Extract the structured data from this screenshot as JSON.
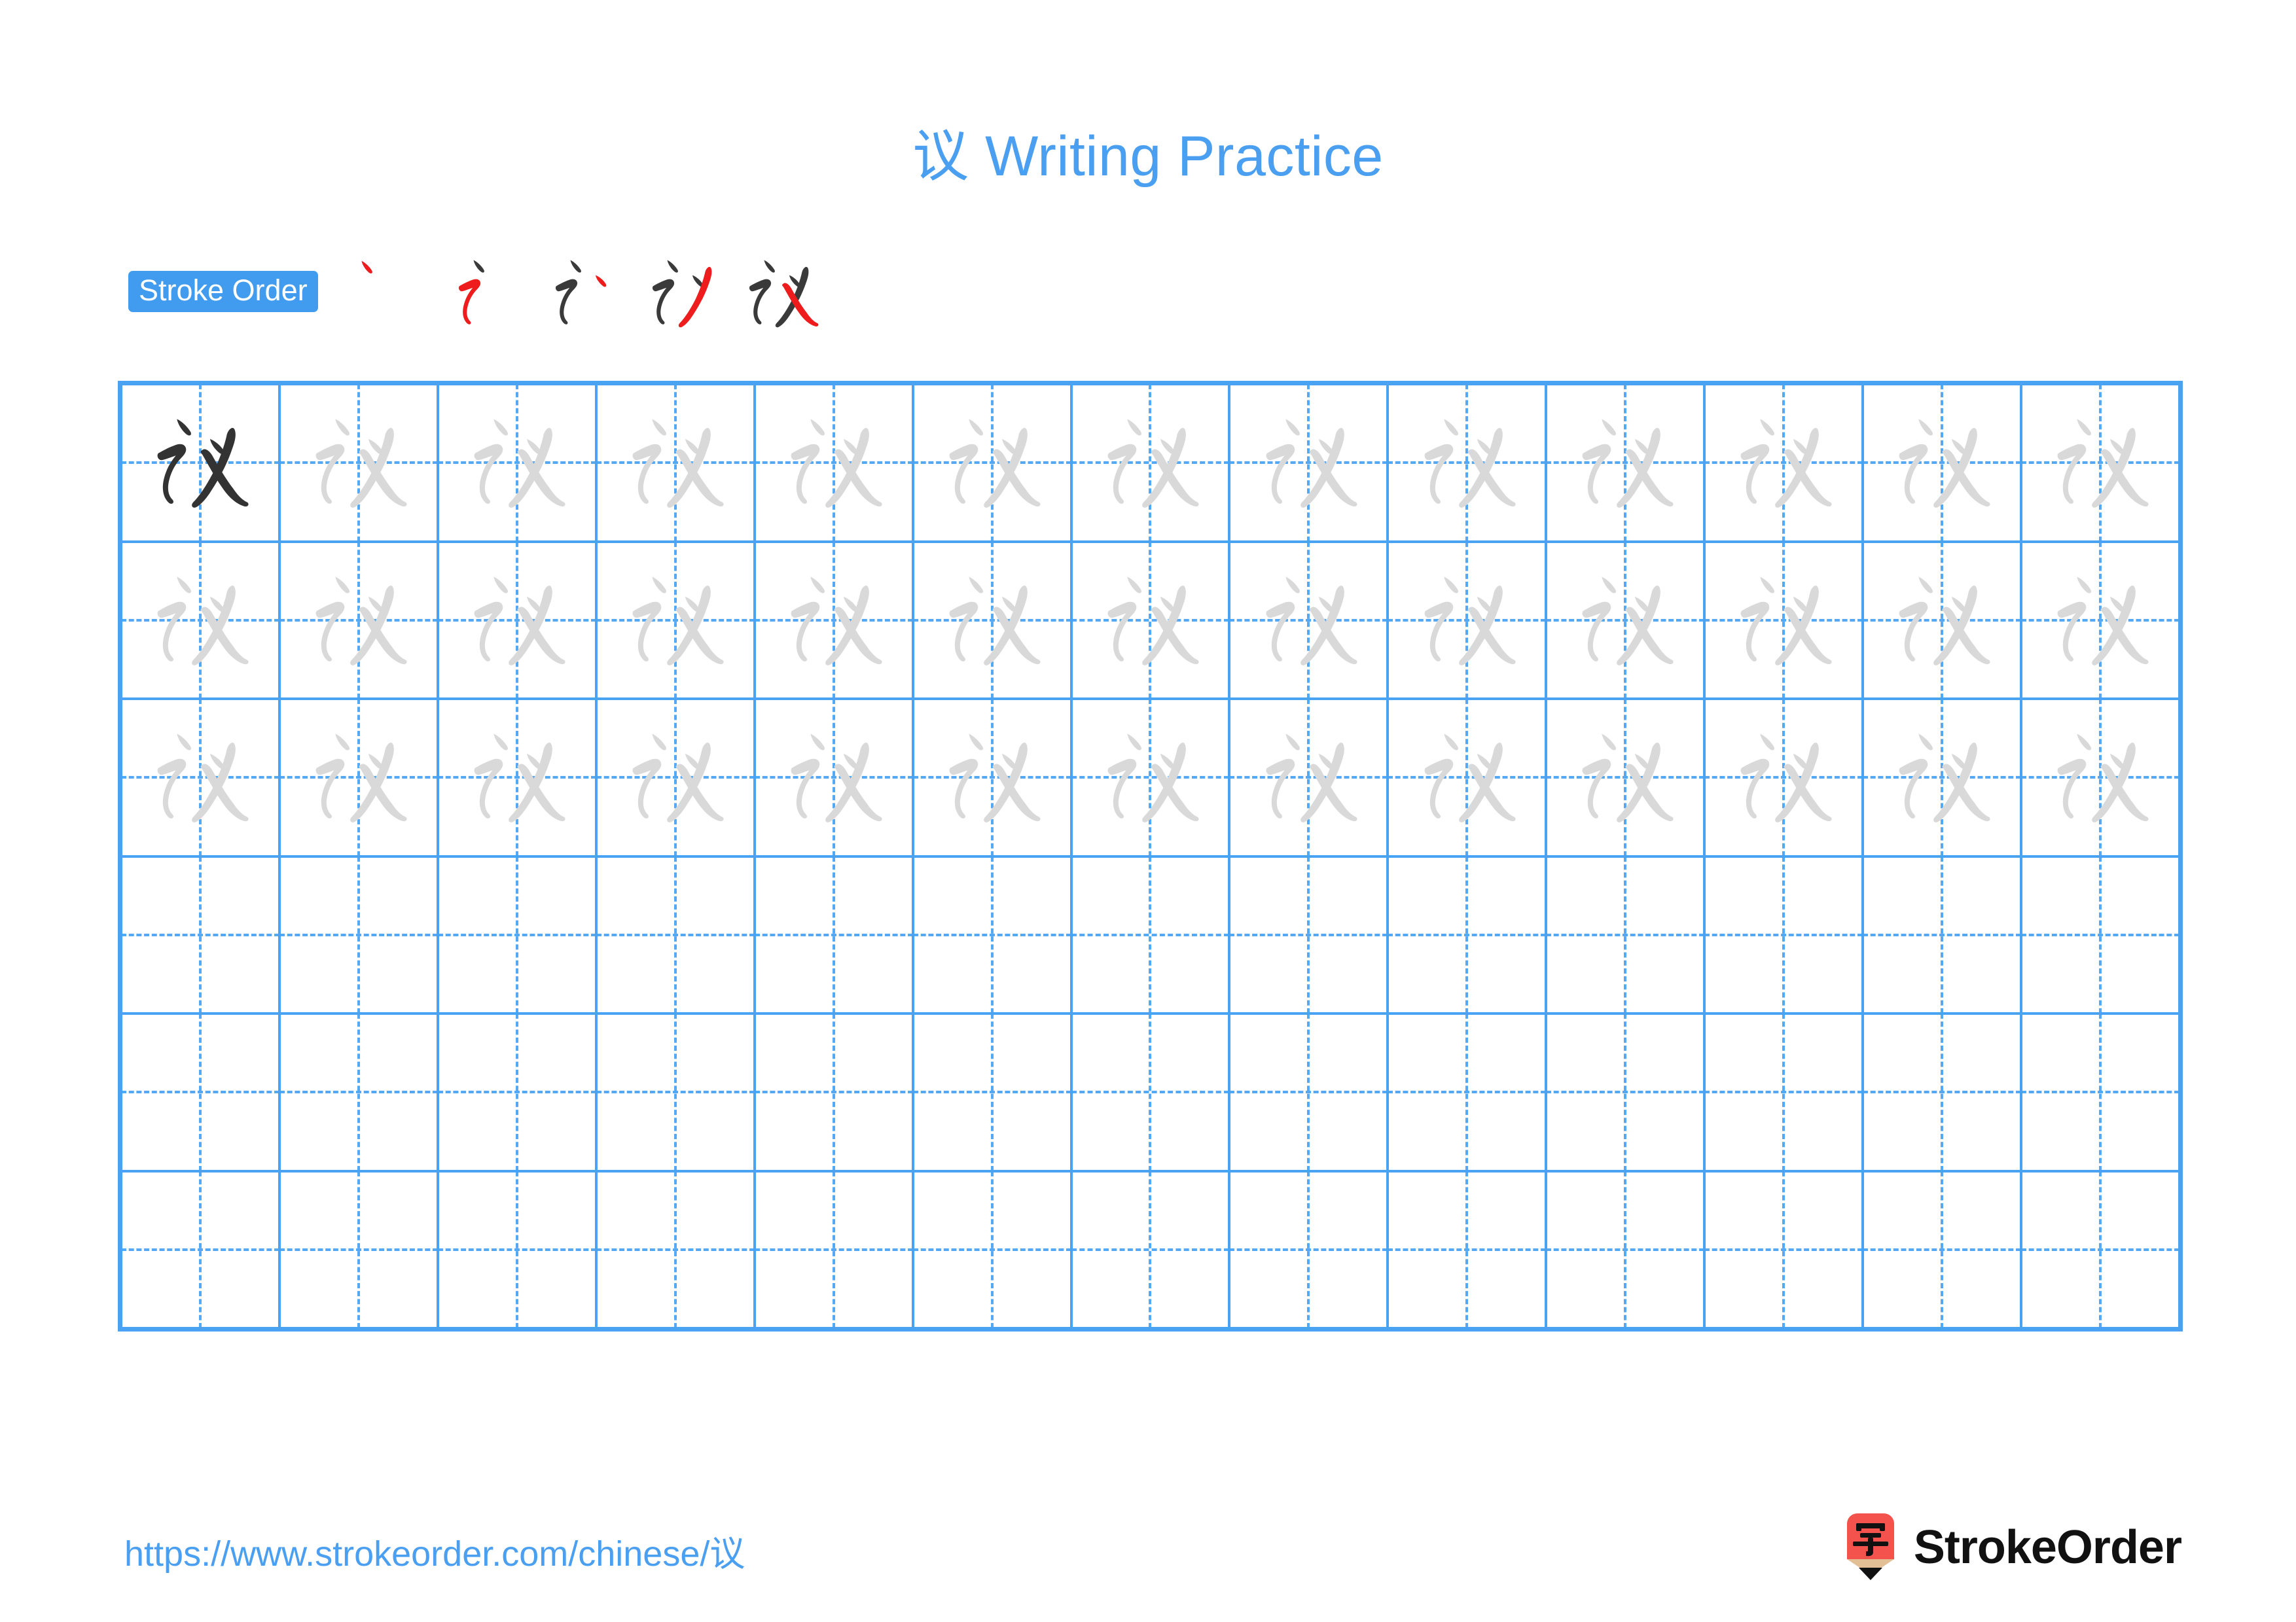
{
  "character": "议",
  "title": "议 Writing Practice",
  "colors": {
    "accent_blue": "#4a9ff0",
    "grid_blue": "#4aa2f2",
    "guide_blue": "#55a8f4",
    "stroke_new": "#ee1c1c",
    "stroke_done": "#3a3a3a",
    "trace_gray": "#d9d9d9",
    "dark_glyph": "#333333",
    "logo_red": "#f4534d",
    "logo_wood": "#e3bf96",
    "logo_tip": "#111111"
  },
  "stroke_order": {
    "badge_label": "Stroke Order",
    "total_strokes": 5,
    "steps": [
      {
        "index": 1,
        "new_stroke": "丶",
        "cumulative": "丶"
      },
      {
        "index": 2,
        "new_stroke": "㇊",
        "cumulative": "讠"
      },
      {
        "index": 3,
        "new_stroke": "丶",
        "cumulative": "讠丶"
      },
      {
        "index": 4,
        "new_stroke": "丿",
        "cumulative": "议(4)"
      },
      {
        "index": 5,
        "new_stroke": "㇏",
        "cumulative": "议"
      }
    ]
  },
  "grid": {
    "columns": 13,
    "rows": 6,
    "character_rows": 3,
    "blank_rows": 3,
    "first_cell_style": "dark",
    "trace_cell_style": "light-gray"
  },
  "footer": {
    "url": "https://www.strokeorder.com/chinese/议",
    "brand_name": "StrokeOrder",
    "brand_mark_character": "字"
  }
}
